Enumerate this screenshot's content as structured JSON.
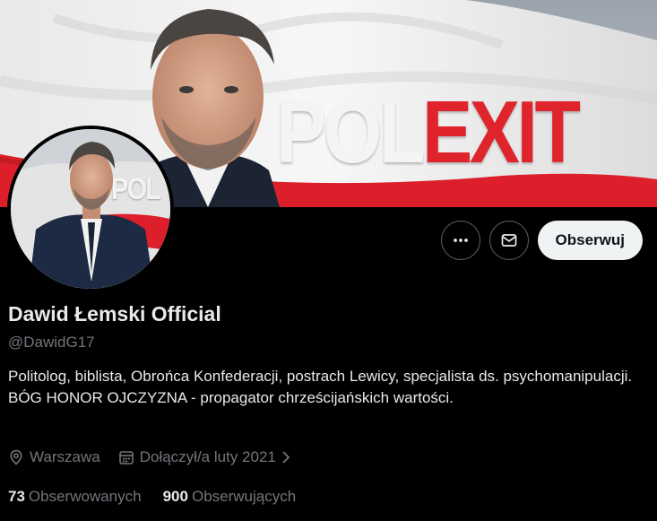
{
  "banner": {
    "text_pol": "POL",
    "text_exit": "EXIT"
  },
  "avatar": {
    "text": "POL"
  },
  "actions": {
    "more_icon": "more-horizontal-icon",
    "message_icon": "envelope-icon",
    "follow_label": "Obserwuj"
  },
  "profile": {
    "display_name": "Dawid Łemski Official",
    "handle": "@DawidG17",
    "bio": "Politolog, biblista, Obrońca Konfederacji, postrach Lewicy, specjalista ds. psychomanipulacji. BÓG HONOR OJCZYZNA - propagator chrześcijańskich wartości.",
    "location": "Warszawa",
    "joined": "Dołączył/a luty 2021"
  },
  "stats": {
    "following_count": "73",
    "following_label": "Obserwowanych",
    "followers_count": "900",
    "followers_label": "Obserwujących"
  },
  "colors": {
    "background": "#000000",
    "text": "#e7e9ea",
    "muted": "#71767b",
    "button_bg": "#eff3f4",
    "flag_red": "#dc1f2a"
  }
}
